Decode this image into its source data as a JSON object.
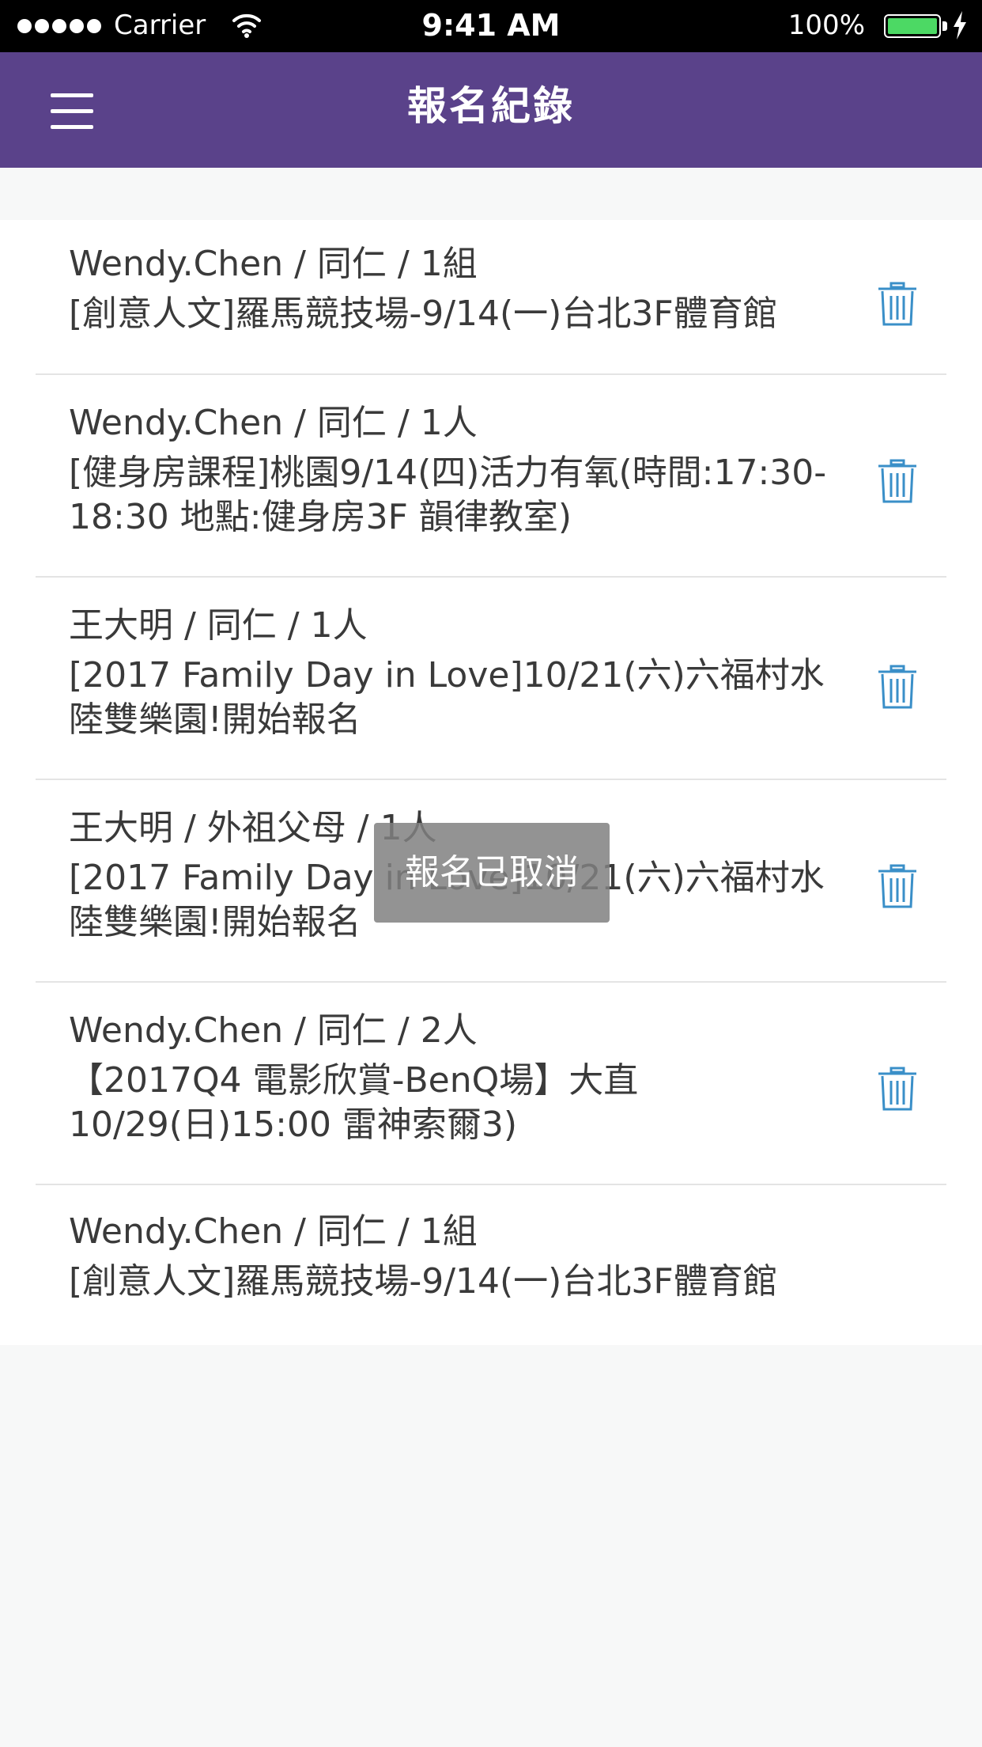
{
  "status": {
    "carrier": "Carrier",
    "time": "9:41 AM",
    "battery": "100%"
  },
  "nav": {
    "title": "報名紀錄"
  },
  "records": [
    {
      "meta": "Wendy.Chen / 同仁 / 1組",
      "title": "[創意人文]羅馬競技場-9/14(一)台北3F體育館",
      "deletable": true
    },
    {
      "meta": "Wendy.Chen / 同仁 / 1人",
      "title": "[健身房課程]桃園9/14(四)活力有氧(時間:17:30-18:30 地點:健身房3F 韻律教室)",
      "deletable": true
    },
    {
      "meta": "王大明 / 同仁 / 1人",
      "title": "[2017 Family Day in Love]10/21(六)六福村水陸雙樂園!開始報名",
      "deletable": true
    },
    {
      "meta": "王大明 / 外祖父母 / 1人",
      "title": "[2017 Family Day in Love]10/21(六)六福村水陸雙樂園!開始報名",
      "deletable": true
    },
    {
      "meta": "Wendy.Chen / 同仁 / 2人",
      "title": "【2017Q4 電影欣賞-BenQ場】大直10/29(日)15:00 雷神索爾3)",
      "deletable": true
    },
    {
      "meta": "Wendy.Chen / 同仁 / 1組",
      "title": "[創意人文]羅馬競技場-9/14(一)台北3F體育館",
      "deletable": false
    }
  ],
  "toast": {
    "message": "報名已取消"
  },
  "colors": {
    "nav_background": "#5a428a",
    "trash_icon": "#3a8fc8",
    "page_background": "#f7f8f8"
  }
}
